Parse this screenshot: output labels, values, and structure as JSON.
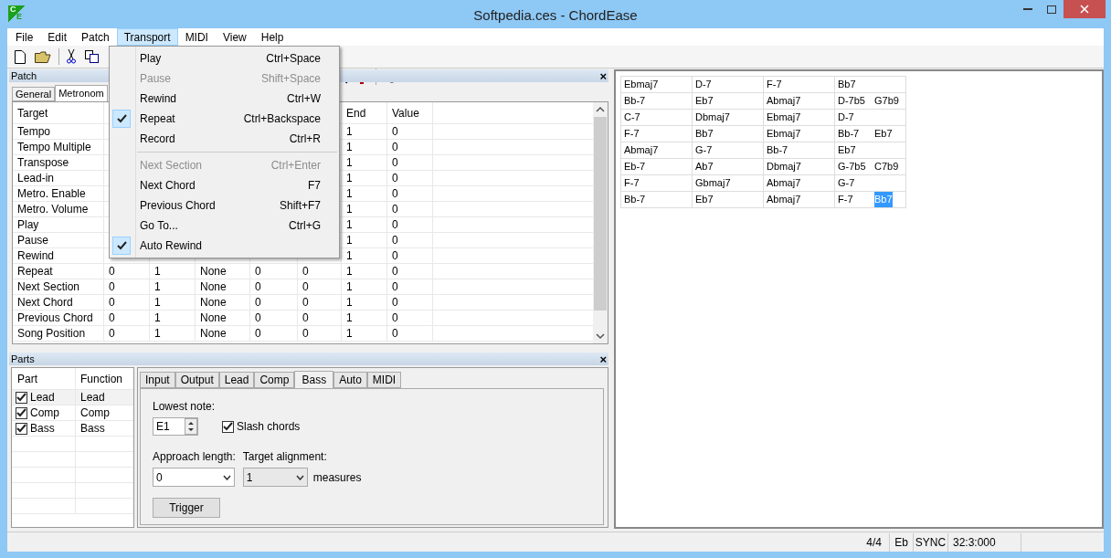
{
  "window": {
    "title": "Softpedia.ces - ChordEase",
    "logo_letters": [
      "C",
      "E"
    ]
  },
  "menu_bar": [
    {
      "label": "File",
      "selected": false
    },
    {
      "label": "Edit",
      "selected": false
    },
    {
      "label": "Patch",
      "selected": false
    },
    {
      "label": "Transport",
      "selected": true
    },
    {
      "label": "MIDI",
      "selected": false
    },
    {
      "label": "View",
      "selected": false
    },
    {
      "label": "Help",
      "selected": false
    }
  ],
  "transport_menu": [
    {
      "kind": "item",
      "label": "Play",
      "shortcut": "Ctrl+Space",
      "checked": false,
      "disabled": false
    },
    {
      "kind": "item",
      "label": "Pause",
      "shortcut": "Shift+Space",
      "checked": false,
      "disabled": true
    },
    {
      "kind": "item",
      "label": "Rewind",
      "shortcut": "Ctrl+W",
      "checked": false,
      "disabled": false
    },
    {
      "kind": "item",
      "label": "Repeat",
      "shortcut": "Ctrl+Backspace",
      "checked": true,
      "disabled": false
    },
    {
      "kind": "item",
      "label": "Record",
      "shortcut": "Ctrl+R",
      "checked": false,
      "disabled": false
    },
    {
      "kind": "separator"
    },
    {
      "kind": "item",
      "label": "Next Section",
      "shortcut": "Ctrl+Enter",
      "checked": false,
      "disabled": true
    },
    {
      "kind": "item",
      "label": "Next Chord",
      "shortcut": "F7",
      "checked": false,
      "disabled": false
    },
    {
      "kind": "item",
      "label": "Previous Chord",
      "shortcut": "Shift+F7",
      "checked": false,
      "disabled": false
    },
    {
      "kind": "item",
      "label": "Go To...",
      "shortcut": "Ctrl+G",
      "checked": false,
      "disabled": false
    },
    {
      "kind": "item",
      "label": "Auto Rewind",
      "checked": true,
      "disabled": false
    }
  ],
  "patch_panel": {
    "title": "Patch",
    "close": "×",
    "tabs": [
      {
        "label": "General",
        "selected": false
      },
      {
        "label": "Metronom",
        "selected": true
      }
    ],
    "table": {
      "first_column": "Target",
      "last_columns": [
        "End",
        "Value"
      ],
      "rows": [
        {
          "target": "Tempo",
          "end": "1",
          "value": "0"
        },
        {
          "target": "Tempo Multiple",
          "end": "1",
          "value": "0"
        },
        {
          "target": "Transpose",
          "end": "1",
          "value": "0"
        },
        {
          "target": "Lead-in",
          "end": "1",
          "value": "0"
        },
        {
          "target": "Metro. Enable",
          "end": "1",
          "value": "0"
        },
        {
          "target": "Metro. Volume",
          "end": "1",
          "value": "0"
        },
        {
          "target": "Play",
          "end": "1",
          "value": "0"
        },
        {
          "target": "Pause",
          "end": "1",
          "value": "0"
        },
        {
          "target": "Rewind",
          "end": "1",
          "value": "0"
        },
        {
          "target": "Repeat",
          "middle": [
            "0",
            "1",
            "None",
            "0",
            "0"
          ],
          "end": "1",
          "value": "0"
        },
        {
          "target": "Next Section",
          "middle": [
            "0",
            "1",
            "None",
            "0",
            "0"
          ],
          "end": "1",
          "value": "0"
        },
        {
          "target": "Next Chord",
          "middle": [
            "0",
            "1",
            "None",
            "0",
            "0"
          ],
          "end": "1",
          "value": "0"
        },
        {
          "target": "Previous Chord",
          "middle": [
            "0",
            "1",
            "None",
            "0",
            "0"
          ],
          "end": "1",
          "value": "0"
        },
        {
          "target": "Song Position",
          "middle": [
            "0",
            "1",
            "None",
            "0",
            "0"
          ],
          "end": "1",
          "value": "0"
        }
      ]
    }
  },
  "parts_panel": {
    "title": "Parts",
    "close": "×",
    "columns": [
      "Part",
      "Function"
    ],
    "rows": [
      {
        "part": "Lead",
        "function": "Lead",
        "checked": true,
        "selected": true
      },
      {
        "part": "Comp",
        "function": "Comp",
        "checked": true,
        "selected": false
      },
      {
        "part": "Bass",
        "function": "Bass",
        "checked": true,
        "selected": false
      }
    ],
    "tabs": [
      {
        "label": "Input",
        "selected": false
      },
      {
        "label": "Output",
        "selected": false
      },
      {
        "label": "Lead",
        "selected": false
      },
      {
        "label": "Comp",
        "selected": false
      },
      {
        "label": "Bass",
        "selected": true
      },
      {
        "label": "Auto",
        "selected": false
      },
      {
        "label": "MIDI",
        "selected": false
      }
    ],
    "lowest_note": {
      "label": "Lowest note:",
      "value": "E1"
    },
    "slash_chords": {
      "label": "Slash chords",
      "checked": true
    },
    "approach_length": {
      "label": "Approach length:",
      "value": "0"
    },
    "target_alignment": {
      "label": "Target alignment:",
      "value": "1",
      "unit": "measures"
    },
    "trigger_button": "Trigger"
  },
  "chord_chart": [
    [
      [
        {
          "text": "Ebmaj7",
          "selected": false
        }
      ],
      [
        {
          "text": "D-7",
          "selected": false
        }
      ],
      [
        {
          "text": "F-7",
          "selected": false
        }
      ],
      [
        {
          "text": "Bb7",
          "selected": false
        }
      ]
    ],
    [
      [
        {
          "text": "Bb-7",
          "selected": false
        }
      ],
      [
        {
          "text": "Eb7",
          "selected": false
        }
      ],
      [
        {
          "text": "Abmaj7",
          "selected": false
        }
      ],
      [
        {
          "text": "D-7b5",
          "selected": false
        },
        {
          "text": "G7b9",
          "selected": false
        }
      ]
    ],
    [
      [
        {
          "text": "C-7",
          "selected": false
        }
      ],
      [
        {
          "text": "Dbmaj7",
          "selected": false
        }
      ],
      [
        {
          "text": "Ebmaj7",
          "selected": false
        }
      ],
      [
        {
          "text": "D-7",
          "selected": false
        }
      ]
    ],
    [
      [
        {
          "text": "F-7",
          "selected": false
        }
      ],
      [
        {
          "text": "Bb7",
          "selected": false
        }
      ],
      [
        {
          "text": "Ebmaj7",
          "selected": false
        }
      ],
      [
        {
          "text": "Bb-7",
          "selected": false
        },
        {
          "text": "Eb7",
          "selected": false
        }
      ]
    ],
    [
      [
        {
          "text": "Abmaj7",
          "selected": false
        }
      ],
      [
        {
          "text": "G-7",
          "selected": false
        }
      ],
      [
        {
          "text": "Bb-7",
          "selected": false
        }
      ],
      [
        {
          "text": "Eb7",
          "selected": false
        }
      ]
    ],
    [
      [
        {
          "text": "Eb-7",
          "selected": false
        }
      ],
      [
        {
          "text": "Ab7",
          "selected": false
        }
      ],
      [
        {
          "text": "Dbmaj7",
          "selected": false
        }
      ],
      [
        {
          "text": "G-7b5",
          "selected": false
        },
        {
          "text": "C7b9",
          "selected": false
        }
      ]
    ],
    [
      [
        {
          "text": "F-7",
          "selected": false
        }
      ],
      [
        {
          "text": "Gbmaj7",
          "selected": false
        }
      ],
      [
        {
          "text": "Abmaj7",
          "selected": false
        }
      ],
      [
        {
          "text": "G-7",
          "selected": false
        }
      ]
    ],
    [
      [
        {
          "text": "Bb-7",
          "selected": false
        }
      ],
      [
        {
          "text": "Eb7",
          "selected": false
        }
      ],
      [
        {
          "text": "Abmaj7",
          "selected": false
        }
      ],
      [
        {
          "text": "F-7",
          "selected": false
        },
        {
          "text": "Bb7",
          "selected": true
        }
      ]
    ]
  ],
  "status_bar": [
    "4/4",
    "Eb",
    "SYNC",
    "32:3:000"
  ]
}
